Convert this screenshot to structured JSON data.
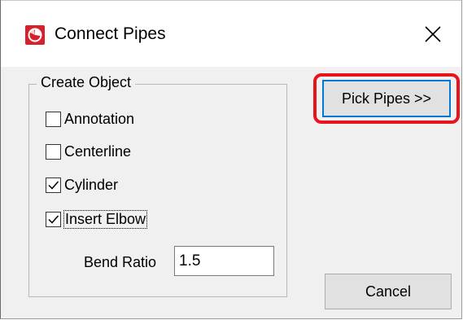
{
  "window": {
    "title": "Connect Pipes",
    "app_icon": "autodesk-plant-logo-icon",
    "close_icon": "close-icon",
    "accent_color": "#0078d7",
    "highlight_color": "#e8141c"
  },
  "create_object": {
    "group_label": "Create Object",
    "options": [
      {
        "label": "Annotation",
        "checked": false
      },
      {
        "label": "Centerline",
        "checked": false
      },
      {
        "label": "Cylinder",
        "checked": true
      },
      {
        "label": "Insert Elbow",
        "checked": true,
        "focused": true
      }
    ],
    "bend_ratio_label": "Bend Ratio",
    "bend_ratio_value": "1.5"
  },
  "buttons": {
    "pick_pipes": "Pick Pipes >>",
    "cancel": "Cancel"
  }
}
